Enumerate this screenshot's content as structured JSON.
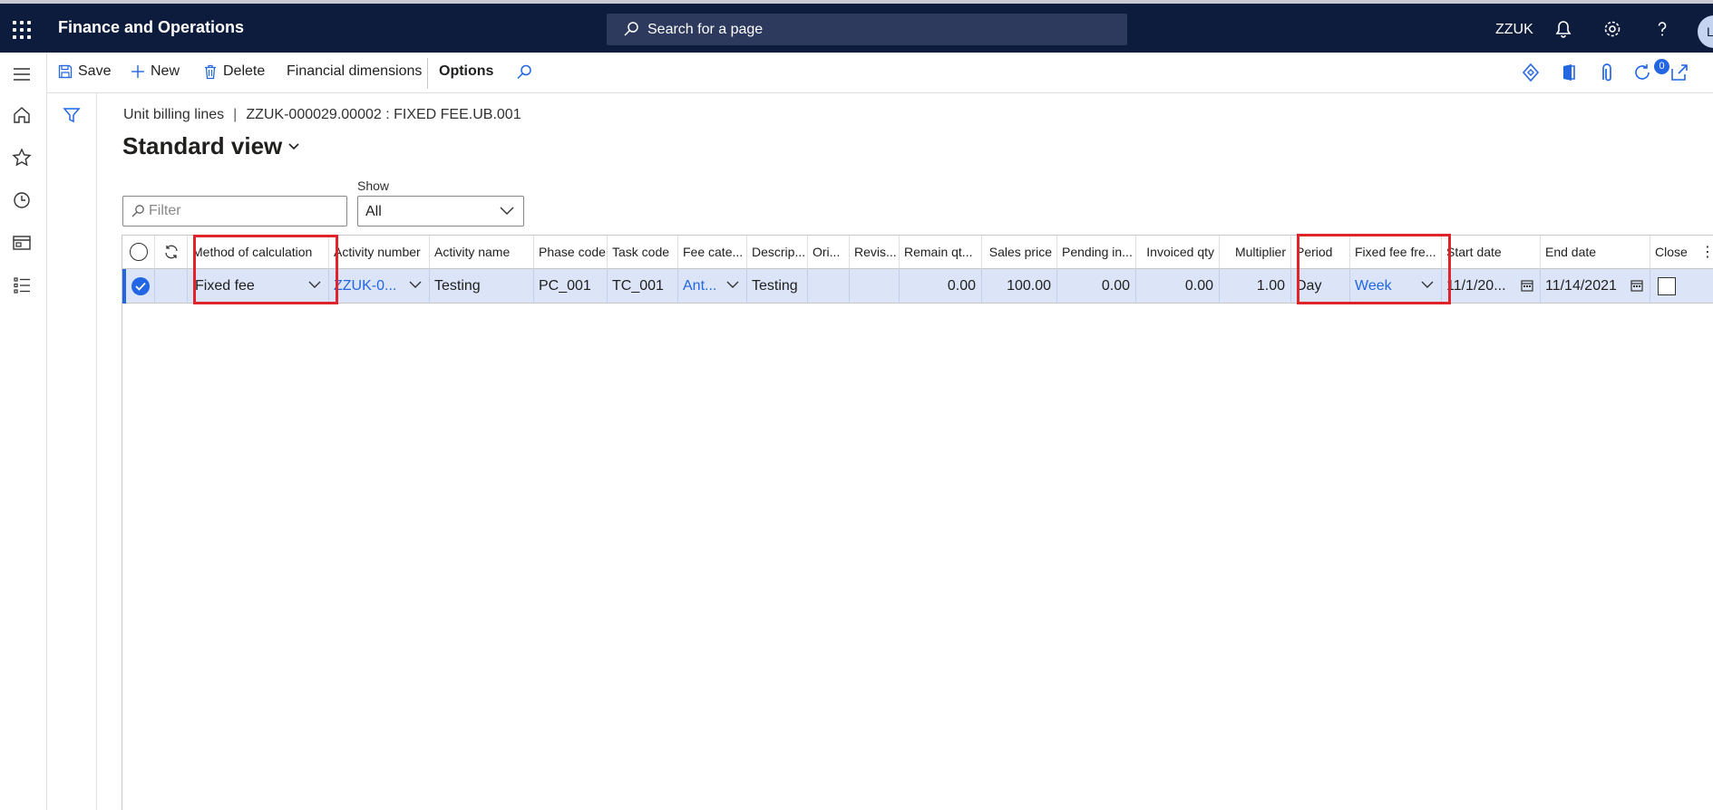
{
  "header": {
    "app_title": "Finance and Operations",
    "search_placeholder": "Search for a page",
    "company": "ZZUK",
    "avatar_initial": "L"
  },
  "actions": {
    "save": "Save",
    "new": "New",
    "delete": "Delete",
    "financial_dimensions": "Financial dimensions",
    "options": "Options",
    "attachments_count": "0"
  },
  "page": {
    "breadcrumb_form": "Unit billing lines",
    "breadcrumb_separator": "|",
    "breadcrumb_record": "ZZUK-000029.00002 : FIXED FEE.UB.001",
    "view_title": "Standard view",
    "filter_placeholder": "Filter",
    "show_label": "Show",
    "show_value": "All"
  },
  "grid": {
    "columns": {
      "method": "Method of calculation",
      "activity_number": "Activity number",
      "activity_name": "Activity name",
      "phase_code": "Phase code",
      "task_code": "Task code",
      "fee_category": "Fee cate...",
      "description": "Descrip...",
      "original": "Ori...",
      "revised": "Revis...",
      "remain_qty": "Remain qt...",
      "sales_price": "Sales price",
      "pending_invoice": "Pending in...",
      "invoiced_qty": "Invoiced qty",
      "multiplier": "Multiplier",
      "period": "Period",
      "fixed_fee_frequency": "Fixed fee fre...",
      "start_date": "Start date",
      "end_date": "End date",
      "close": "Close"
    },
    "row": {
      "method": "Fixed fee",
      "activity_number": "ZZUK-0...",
      "activity_name": "Testing",
      "phase_code": "PC_001",
      "task_code": "TC_001",
      "fee_category": "Ant...",
      "description": "Testing",
      "original": "",
      "revised": "",
      "remain_qty": "0.00",
      "sales_price": "100.00",
      "pending_invoice": "0.00",
      "invoiced_qty": "0.00",
      "multiplier": "1.00",
      "period": "Day",
      "fixed_fee_frequency": "Week",
      "start_date": "11/1/20...",
      "end_date": "11/14/2021",
      "close_checked": false
    }
  },
  "colors": {
    "navbar": "#0d1b3d",
    "accent": "#2266e3",
    "selected_row": "#dbe5f7",
    "highlight": "#e0242c"
  }
}
